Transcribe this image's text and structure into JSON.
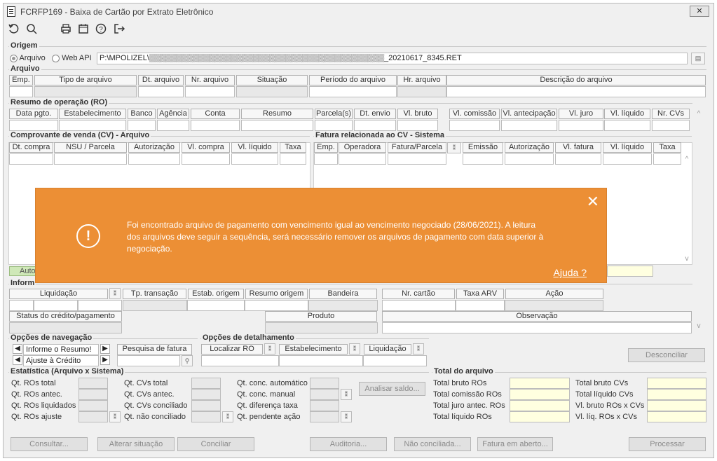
{
  "window": {
    "title": "FCRFP169 - Baixa de Cartão por Extrato Eletrônico",
    "close": "✕"
  },
  "toolbar": {
    "icons": [
      "undo-icon",
      "search-icon",
      "print-icon",
      "calendar-icon",
      "help-icon",
      "exit-icon"
    ]
  },
  "origem": {
    "group": "Origem",
    "radio_file": "Arquivo",
    "radio_web": "Web API",
    "path": "P:\\MPOLIZEL\\▒▒▒▒▒▒▒▒▒▒▒▒▒▒▒▒▒▒▒▒▒▒▒▒▒▒▒▒▒▒▒▒▒▒▒▒▒▒▒▒▒▒▒_20210617_8345.RET"
  },
  "arquivo": {
    "group": "Arquivo",
    "cols": [
      "Emp.",
      "Tipo de arquivo",
      "Dt. arquivo",
      "Nr. arquivo",
      "Situação",
      "Período do arquivo",
      "Hr. arquivo",
      "Descrição do arquivo"
    ]
  },
  "resumo": {
    "group": "Resumo de operação (RO)",
    "cols": [
      "Data pgto.",
      "Estabelecimento",
      "Banco",
      "Agência",
      "Conta",
      "Resumo",
      "Parcela(s)",
      "Dt. envio",
      "Vl. bruto",
      "Vl. comissão",
      "Vl. antecipação",
      "Vl. juro",
      "Vl. líquido",
      "Nr. CVs"
    ]
  },
  "cv": {
    "group": "Comprovante de venda (CV) - Arquivo",
    "cols": [
      "Dt. compra",
      "NSU / Parcela",
      "Autorização",
      "Vl. compra",
      "Vl. líquido",
      "Taxa"
    ]
  },
  "fatura": {
    "group": "Fatura relacionada ao CV - Sistema",
    "cols": [
      "Emp.",
      "Operadora",
      "Fatura/Parcela",
      "Emissão",
      "Autorização",
      "Vl. fatura",
      "Vl. líquido",
      "Taxa"
    ]
  },
  "hidden_label": "Auto",
  "info": {
    "group": "Inform",
    "cols_left": [
      "Liquidação",
      "Tp. transação",
      "Estab. origem",
      "Resumo origem",
      "Bandeira"
    ],
    "status": "Status do crédito/pagamento",
    "produto": "Produto",
    "cols_right": [
      "Nr. cartão",
      "Taxa ARV",
      "Ação"
    ],
    "observacao": "Observação"
  },
  "navegacao": {
    "group": "Opções de navegação",
    "select1": "Informe o Resumo!",
    "select2": "Ajuste à Crédito",
    "search_btn": "Pesquisa de fatura"
  },
  "detalhamento": {
    "group": "Opções de detalhamento",
    "cols": [
      "Localizar RO",
      "Estabelecimento",
      "Liquidação"
    ]
  },
  "desconciliar": "Desconciliar",
  "estatistica": {
    "group": "Estatística (Arquivo x Sistema)",
    "col1": [
      "Qt. ROs total",
      "Qt. ROs antec.",
      "Qt. ROs liquidados",
      "Qt. ROs ajuste"
    ],
    "col2": [
      "Qt. CVs total",
      "Qt. CVs antec.",
      "Qt. CVs conciliado",
      "Qt. não conciliado"
    ],
    "col3": [
      "Qt. conc. automático",
      "Qt. conc. manual",
      "Qt. diferença taxa",
      "Qt. pendente ação"
    ],
    "analisar": "Analisar saldo..."
  },
  "total": {
    "group": "Total do arquivo",
    "col1": [
      "Total bruto ROs",
      "Total comissão ROs",
      "Total juro antec. ROs",
      "Total líquido ROs"
    ],
    "col2": [
      "Total bruto CVs",
      "Total líquido CVs",
      "Vl. bruto ROs x CVs",
      "Vl. líq. ROs x CVs"
    ]
  },
  "buttons": [
    "Consultar...",
    "Alterar situação",
    "Conciliar",
    "Auditoria...",
    "Não conciliada...",
    "Fatura em aberto...",
    "Processar"
  ],
  "toast": {
    "message": "Foi encontrado arquivo de pagamento com vencimento igual ao vencimento negociado (28/06/2021). A leitura dos arquivos deve seguir a sequência, será necessário remover os arquivos de pagamento com data superior à negociação.",
    "help": "Ajuda ?",
    "close": "✕",
    "icon": "!",
    "color": "#ec8f35"
  }
}
